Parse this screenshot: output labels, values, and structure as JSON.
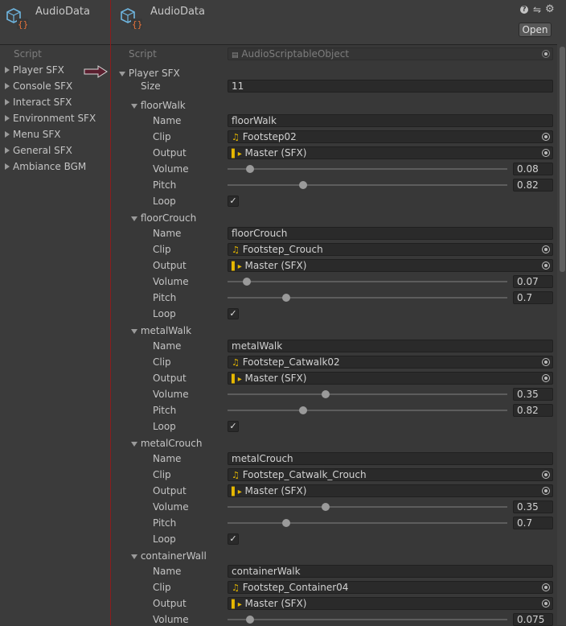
{
  "left": {
    "title": "AudioData",
    "script_label": "Script",
    "items": [
      {
        "label": "Player SFX"
      },
      {
        "label": "Console SFX"
      },
      {
        "label": "Interact SFX"
      },
      {
        "label": "Environment SFX"
      },
      {
        "label": "Menu SFX"
      },
      {
        "label": "General SFX"
      },
      {
        "label": "Ambiance BGM"
      }
    ]
  },
  "right": {
    "title": "AudioData",
    "open_label": "Open",
    "header_icons": [
      "help-icon",
      "settings-sliders-icon",
      "gear-icon"
    ],
    "script_label": "Script",
    "script_value": "AudioScriptableObject",
    "section_label": "Player SFX",
    "size_label": "Size",
    "size_value": "11",
    "field_labels": {
      "name": "Name",
      "clip": "Clip",
      "output": "Output",
      "volume": "Volume",
      "pitch": "Pitch",
      "loop": "Loop"
    },
    "entries": [
      {
        "header": "floorWalk",
        "name": "floorWalk",
        "clip": "Footstep02",
        "output": "Master (SFX)",
        "volume": "0.08",
        "volume_norm": 0.08,
        "pitch": "0.82",
        "pitch_norm": 0.27,
        "loop": true
      },
      {
        "header": "floorCrouch",
        "name": "floorCrouch",
        "clip": "Footstep_Crouch",
        "output": "Master (SFX)",
        "volume": "0.07",
        "volume_norm": 0.07,
        "pitch": "0.7",
        "pitch_norm": 0.21,
        "loop": true
      },
      {
        "header": "metalWalk",
        "name": "metalWalk",
        "clip": "Footstep_Catwalk02",
        "output": "Master (SFX)",
        "volume": "0.35",
        "volume_norm": 0.35,
        "pitch": "0.82",
        "pitch_norm": 0.27,
        "loop": true
      },
      {
        "header": "metalCrouch",
        "name": "metalCrouch",
        "clip": "Footstep_Catwalk_Crouch",
        "output": "Master (SFX)",
        "volume": "0.35",
        "volume_norm": 0.35,
        "pitch": "0.7",
        "pitch_norm": 0.21,
        "loop": true
      },
      {
        "header": "containerWall",
        "name": "containerWalk",
        "clip": "Footstep_Container04",
        "output": "Master (SFX)",
        "volume": "0.075",
        "volume_norm": 0.08
      }
    ]
  }
}
